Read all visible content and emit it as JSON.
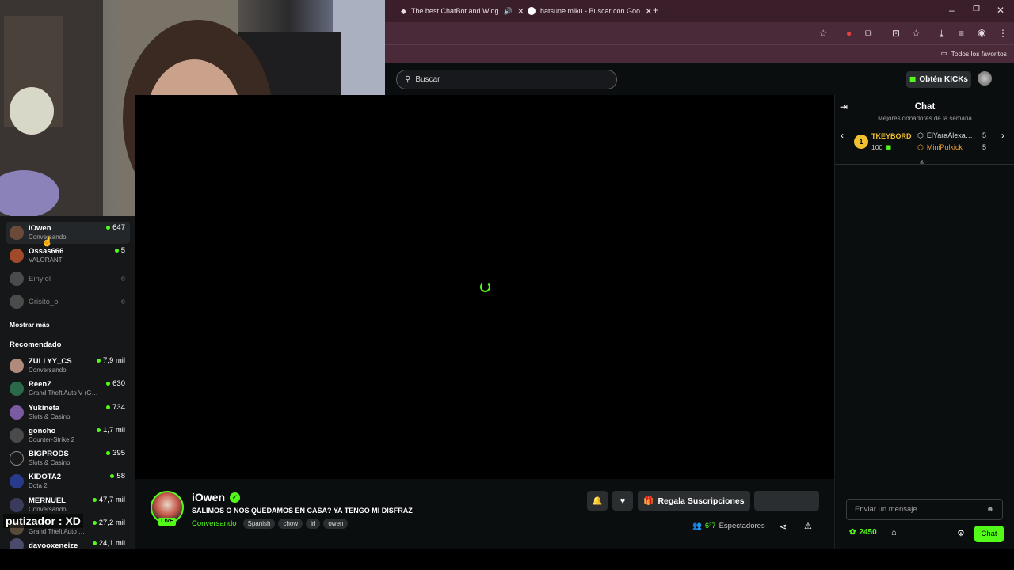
{
  "browser": {
    "tabs": [
      {
        "title": "The best ChatBot and Widg",
        "icon": "chatbot-icon",
        "audio": true
      },
      {
        "title": "hatsune miku - Buscar con Goo",
        "icon": "google-icon",
        "audio": false
      }
    ],
    "new_tab": "+",
    "bookmarks_label": "Todos los favoritos",
    "window_controls": [
      "minimize",
      "restore",
      "close"
    ]
  },
  "header": {
    "search_placeholder": "Buscar",
    "kicks_button": "Obtén KICKs"
  },
  "sidebar": {
    "following": [
      {
        "name": "iOwen",
        "subtitle": "Conversando",
        "viewers": "647",
        "live": true,
        "avatar_color": "#6b4a3a"
      },
      {
        "name": "Ossas666",
        "subtitle": "VALORANT",
        "viewers": "5",
        "live": true,
        "avatar_color": "#a04a2a"
      },
      {
        "name": "Einyiel",
        "subtitle": "",
        "viewers": "",
        "live": false,
        "avatar_color": "#8a8a8a"
      },
      {
        "name": "Crisito_o",
        "subtitle": "",
        "viewers": "",
        "live": false,
        "avatar_color": "#8a8a8a"
      }
    ],
    "show_more": "Mostrar más",
    "recommended_title": "Recomendado",
    "recommended": [
      {
        "name": "ZULLYY_CS",
        "subtitle": "Conversando",
        "viewers": "7,9 mil",
        "avatar_color": "#b08a7a"
      },
      {
        "name": "ReenZ",
        "subtitle": "Grand Theft Auto V (G…",
        "viewers": "630",
        "avatar_color": "#2a6a4a"
      },
      {
        "name": "Yukineta",
        "subtitle": "Slots & Casino",
        "viewers": "734",
        "avatar_color": "#7a5aa0"
      },
      {
        "name": "goncho",
        "subtitle": "Counter-Strike 2",
        "viewers": "1,7 mil",
        "avatar_color": "#4a4a4a"
      },
      {
        "name": "BIGPRODS",
        "subtitle": "Slots & Casino",
        "viewers": "395",
        "avatar_color": "#1a1a1a"
      },
      {
        "name": "KIDOTA2",
        "subtitle": "Dota 2",
        "viewers": "58",
        "avatar_color": "#2a3a8a"
      },
      {
        "name": "MERNUEL",
        "subtitle": "Conversando",
        "viewers": "47,7 mil",
        "avatar_color": "#3a3a5a"
      },
      {
        "name": "",
        "subtitle": "Grand Theft Auto …",
        "viewers": "27,2 mil",
        "avatar_color": "#5a4a3a"
      },
      {
        "name": "davooxeneize",
        "subtitle": "",
        "viewers": "24,1 mil",
        "avatar_color": "#4a4a6a"
      }
    ]
  },
  "overlay_chat": {
    "user": "putizador",
    "message": ": XD"
  },
  "stream": {
    "channel": "iOwen",
    "title": "SALIMOS O NOS QUEDAMOS EN CASA? YA TENGO MI DISFRAZ",
    "category": "Conversando",
    "tags": [
      "Spanish",
      "chow",
      "irl",
      "owen"
    ],
    "live_label": "LIVE",
    "gift_button": "Regala Suscripciones",
    "viewers_label": "Espectadores",
    "viewers_count": "6³7"
  },
  "chat": {
    "title": "Chat",
    "gifters_title": "Mejores donadores de la semana",
    "top_gifter": {
      "rank": "1",
      "name": "TKEYBORD",
      "amount": "100"
    },
    "other_gifters": [
      {
        "name": "ElYaraAlexa…",
        "amount": "5",
        "color": "#d8d8d8"
      },
      {
        "name": "MiniPulkick",
        "amount": "5",
        "color": "#f0a030"
      }
    ],
    "input_placeholder": "Enviar un mensaje",
    "kicks_balance": "2450",
    "send_button": "Chat"
  },
  "colors": {
    "accent": "#53fc18",
    "background": "#0b0e0f",
    "panel": "#151718",
    "browser_frame": "#3a1f2b"
  }
}
